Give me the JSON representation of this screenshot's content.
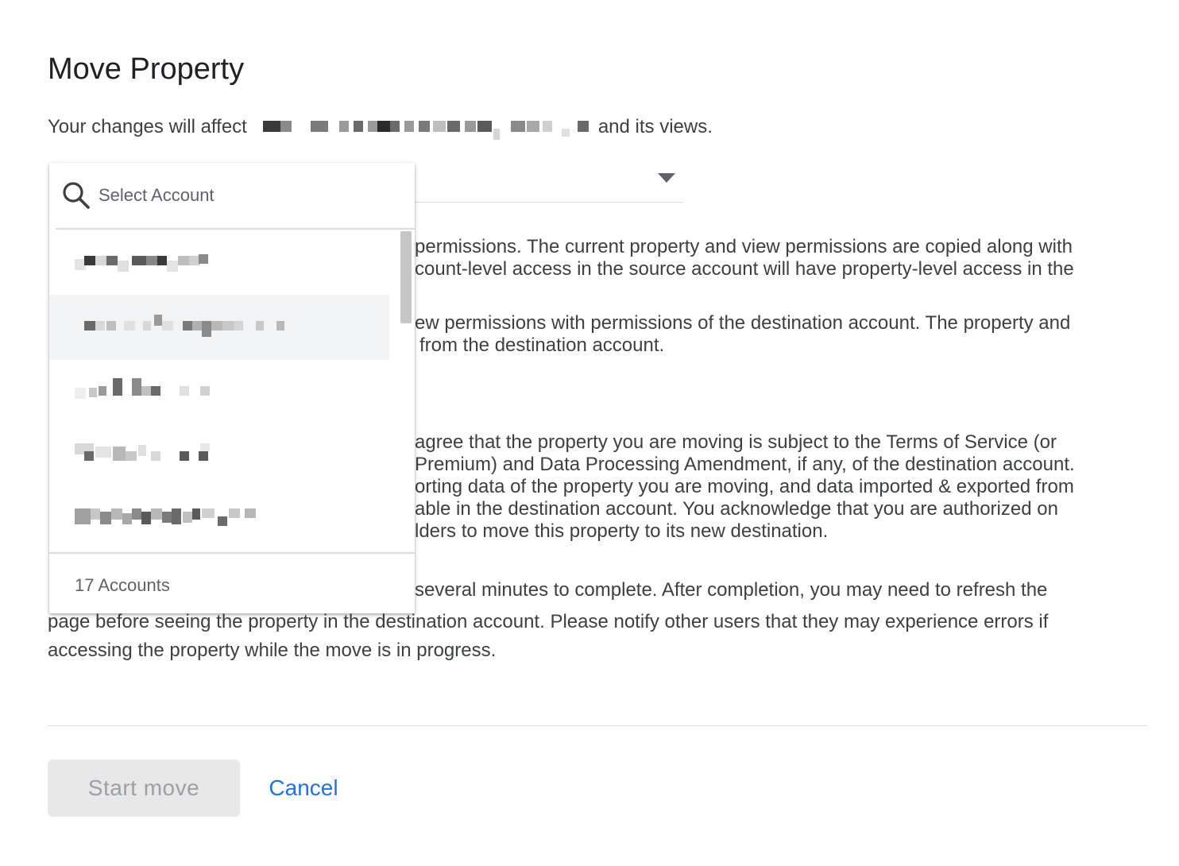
{
  "dialog": {
    "title": "Move Property",
    "affect_prefix": "Your changes will affect",
    "affect_suffix": "and its views."
  },
  "destination_select": {
    "search_placeholder": "Select Account",
    "account_count_label": "17 Accounts",
    "visible_items": 5,
    "highlighted_index": 1,
    "icons": {
      "search": "search-icon",
      "dropdown": "arrow-drop-down-icon"
    }
  },
  "paragraphs": {
    "p1": [
      "permissions. The current property and view permissions are copied along with",
      "count-level access in the source account will have property-level access in the"
    ],
    "p2": [
      "ew permissions with permissions of the destination account. The property and",
      "from the destination account."
    ],
    "p3": [
      "agree that the property you are moving is subject to the Terms of Service (or",
      "Premium) and Data Processing Amendment, if any, of the destination account.",
      "orting data of the property you are moving, and data imported & exported from",
      "able in the destination account. You acknowledge that you are authorized on",
      "lders to move this property to its new destination."
    ],
    "p4": [
      "several minutes to complete. After completion, you may need to refresh the",
      "page before seeing the property in the destination account. Please notify other users that they may experience errors if",
      "accessing the property while the move is in progress."
    ]
  },
  "actions": {
    "start_label": "Start move",
    "cancel_label": "Cancel"
  },
  "colors": {
    "link": "#1a73e8",
    "text": "#3c4043",
    "disabled_bg": "#e8e8e8",
    "disabled_text": "#9aa0a6"
  }
}
